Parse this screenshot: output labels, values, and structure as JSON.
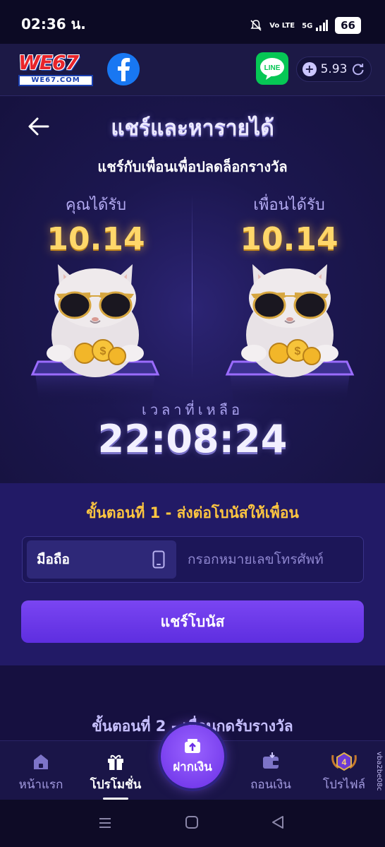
{
  "status_bar": {
    "time": "02:36 น.",
    "network": "Vo LTE",
    "signal": "5G",
    "battery": "66"
  },
  "header": {
    "logo_text": "WE67",
    "logo_subtext": "WE67.COM",
    "balance": "5.93",
    "facebook_icon": "facebook-icon",
    "line_icon": "line-icon",
    "line_label": "LINE"
  },
  "hero": {
    "title": "แชร์และหารายได้",
    "subtitle": "แชร์กับเพื่อนเพื่อปลดล็อกรางวัล",
    "you_receive_label": "คุณได้รับ",
    "you_receive_value": "10.14",
    "friend_receives_label": "เพื่อนได้รับ",
    "friend_receives_value": "10.14",
    "time_left_label": "เวลาที่เหลือ",
    "time_left_value": "22:08:24"
  },
  "step1": {
    "title": "ขั้นตอนที่ 1 - ส่งต่อโบนัสให้เพื่อน",
    "phone_prefix_label": "มือถือ",
    "phone_placeholder": "กรอกหมายเลขโทรศัพท์",
    "phone_value": "",
    "share_button_label": "แชร์โบนัส"
  },
  "step2": {
    "title": "ขั้นตอนที่ 2 - เพื่อนกดรับรางวัล"
  },
  "bottom_nav": {
    "items": [
      {
        "label": "หน้าแรก",
        "icon": "home-icon"
      },
      {
        "label": "โปรโมชั่น",
        "icon": "gift-icon",
        "active": true
      },
      {
        "label": "ฝากเงิน",
        "icon": "deposit-icon"
      },
      {
        "label": "ถอนเงิน",
        "icon": "wallet-icon"
      },
      {
        "label": "โปรไฟล์",
        "icon": "vip-badge-icon",
        "badge": "4"
      }
    ]
  },
  "version": "vba2be08c",
  "colors": {
    "accent_gold": "#ffd76a",
    "step_title": "#ffc640",
    "button_purple": "#6a35e8",
    "background": "#14103a"
  }
}
